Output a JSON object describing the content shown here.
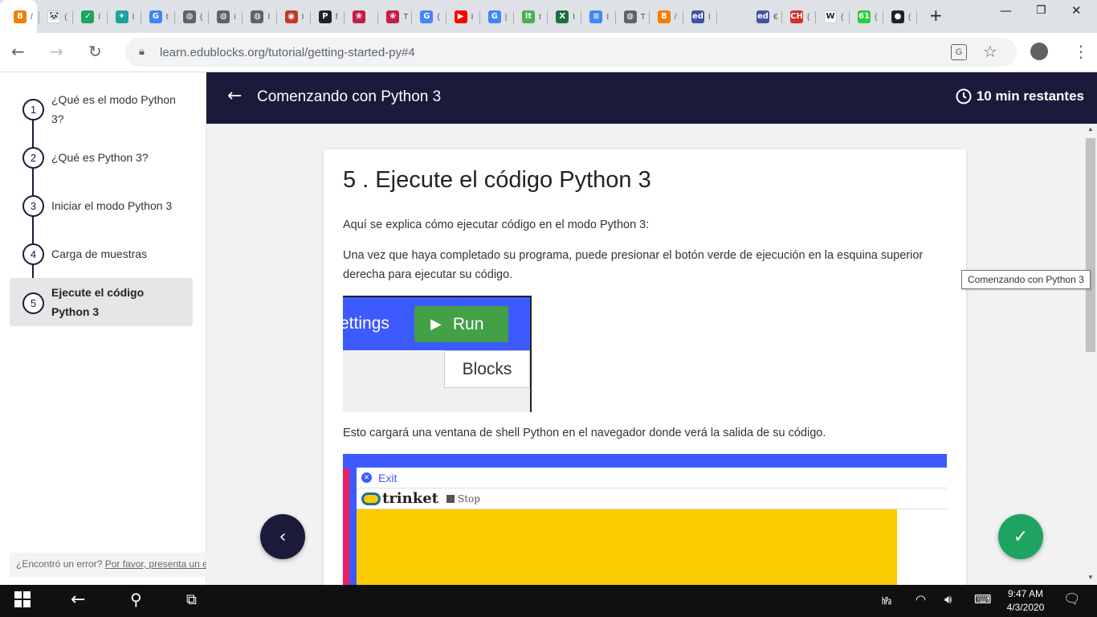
{
  "browser": {
    "tabs": [
      {
        "icon": "blogger-icon",
        "glyph": "B",
        "color": "#f57d00",
        "label": "/"
      },
      {
        "icon": "panda-icon",
        "glyph": "🐼",
        "color": "#ffffff",
        "label": "("
      },
      {
        "icon": "edu-icon",
        "glyph": "✓",
        "color": "#1ea362",
        "label": "I"
      },
      {
        "icon": "app-icon",
        "glyph": "✦",
        "color": "#1ba39c",
        "label": "I"
      },
      {
        "icon": "google-icon",
        "glyph": "G",
        "color": "#4285f4",
        "label": "t"
      },
      {
        "icon": "globe-icon",
        "glyph": "◍",
        "color": "#5f6368",
        "label": "("
      },
      {
        "icon": "globe-icon",
        "glyph": "◍",
        "color": "#5f6368",
        "label": "i"
      },
      {
        "icon": "globe-icon",
        "glyph": "◍",
        "color": "#5f6368",
        "label": "I"
      },
      {
        "icon": "seal-icon",
        "glyph": "◉",
        "color": "#c0392b",
        "label": "I"
      },
      {
        "icon": "p-icon",
        "glyph": "P",
        "color": "#222222",
        "label": "f"
      },
      {
        "icon": "raspberry-icon",
        "glyph": "❀",
        "color": "#c51a4a",
        "label": ""
      },
      {
        "icon": "raspberry-icon",
        "glyph": "❀",
        "color": "#c51a4a",
        "label": "T"
      },
      {
        "icon": "google-icon",
        "glyph": "G",
        "color": "#4285f4",
        "label": "("
      },
      {
        "icon": "youtube-icon",
        "glyph": "▶",
        "color": "#ff0000",
        "label": "I"
      },
      {
        "icon": "google-icon",
        "glyph": "G",
        "color": "#4285f4",
        "label": "|"
      },
      {
        "icon": "sheet-icon",
        "glyph": "it",
        "color": "#4caf50",
        "label": "t"
      },
      {
        "icon": "excel-icon",
        "glyph": "X",
        "color": "#1d6f42",
        "label": "I"
      },
      {
        "icon": "docs-icon",
        "glyph": "≡",
        "color": "#4285f4",
        "label": "I"
      },
      {
        "icon": "globe-icon",
        "glyph": "◍",
        "color": "#5f6368",
        "label": "T"
      },
      {
        "icon": "blogger-icon",
        "glyph": "B",
        "color": "#f57d00",
        "label": "/"
      },
      {
        "icon": "edublocks-icon",
        "glyph": "ed",
        "color": "#3e54a3",
        "label": "I"
      }
    ],
    "tabs_right": [
      {
        "icon": "edublocks-icon",
        "glyph": "ed",
        "color": "#3e54a3",
        "label": "€"
      },
      {
        "icon": "ch-icon",
        "glyph": "CH",
        "color": "#d32f2f",
        "label": "("
      },
      {
        "icon": "wikipedia-icon",
        "glyph": "W",
        "color": "#ffffff",
        "label": "("
      },
      {
        "icon": "counter-icon",
        "glyph": "61",
        "color": "#2ecc40",
        "label": "("
      },
      {
        "icon": "github-icon",
        "glyph": "●",
        "color": "#222222",
        "label": "("
      }
    ],
    "url": "learn.edublocks.org/tutorial/getting-started-py#4"
  },
  "sidebar": {
    "steps": [
      {
        "num": "1",
        "label": "¿Qué es el modo Python 3?"
      },
      {
        "num": "2",
        "label": "¿Qué es Python 3?"
      },
      {
        "num": "3",
        "label": "Iniciar el modo Python 3"
      },
      {
        "num": "4",
        "label": "Carga de muestras"
      },
      {
        "num": "5",
        "label": "Ejecute el código Python 3"
      }
    ],
    "error_text": "¿Encontró un error?",
    "error_link": "Por favor, presenta un error",
    "error_end": "."
  },
  "header": {
    "title": "Comenzando con Python 3",
    "timer": "10 min restantes"
  },
  "content": {
    "heading": "5 . Ejecute el código Python 3",
    "para1": "Aquí se explica cómo ejecutar código en el modo Python 3:",
    "para2": "Una vez que haya completado su programa, puede presionar el botón verde de ejecución en la esquina superior derecha para ejecutar su código.",
    "para3": "Esto cargará una ventana de shell Python en el navegador donde verá la salida de su código.",
    "shot1": {
      "settings": "ettings",
      "run": "Run",
      "blocks": "Blocks"
    },
    "shot2": {
      "exit": "Exit",
      "logo": "trinket",
      "stop": "Stop"
    }
  },
  "tooltip": "Comenzando con Python 3",
  "taskbar": {
    "time": "9:47 AM",
    "date": "4/3/2020"
  },
  "colors": {
    "navy": "#1c1a3b",
    "green": "#1ea362",
    "run_green": "#43a047",
    "blue": "#3d5afe",
    "yellow": "#fccb00"
  }
}
